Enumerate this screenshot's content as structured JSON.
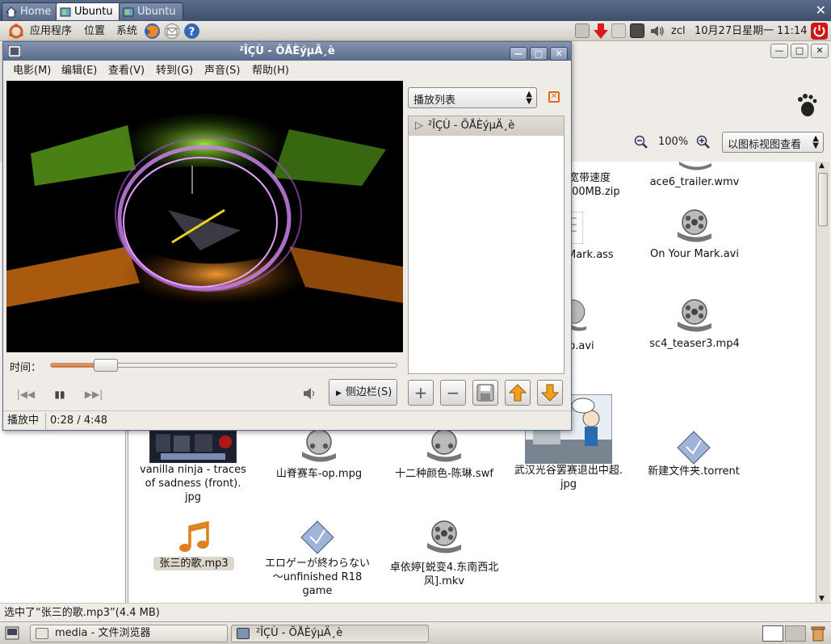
{
  "tabs": [
    {
      "label": "Home",
      "active": false
    },
    {
      "label": "Ubuntu",
      "active": true
    },
    {
      "label": "Ubuntu",
      "active": false
    }
  ],
  "top_panel": {
    "menus": [
      "应用程序",
      "位置",
      "系统"
    ],
    "user": "zcl",
    "date": "10月27日星期一",
    "time": "11:14"
  },
  "file_browser": {
    "zoom": "100%",
    "view_mode": "以图标视图查看",
    "status": "选中了“张三的歌.mp3”(4.4 MB)",
    "files": [
      {
        "name": "…宽带速度 …00MB.zip",
        "l1": "宽带速度",
        "l2": ".00MB.zip",
        "type": "zip"
      },
      {
        "name": "ace6_trailer.wmv",
        "type": "video"
      },
      {
        "name": "Mark.ass",
        "type": "text"
      },
      {
        "name": "On Your Mark.avi",
        "type": "video"
      },
      {
        "name": "p.avi",
        "type": "video"
      },
      {
        "name": "sc4_teaser3.mp4",
        "type": "video"
      },
      {
        "name": "vanilla ninja - traces of sadness (front).jpg",
        "l1": "vanilla ninja - traces",
        "l2": "of sadness (front).",
        "l3": "jpg",
        "type": "image"
      },
      {
        "name": "山脊赛车-op.mpg",
        "type": "video"
      },
      {
        "name": "十二种颜色-陈琳.swf",
        "type": "video"
      },
      {
        "name": "武汉光谷罢赛退出中超.jpg",
        "l1": "武汉光谷罢赛退出中超.",
        "l2": "jpg",
        "type": "image"
      },
      {
        "name": "新建文件夹.torrent",
        "type": "torrent"
      },
      {
        "name": "张三的歌.mp3",
        "type": "audio"
      },
      {
        "name": "エロゲーが終わらない～unfinished R18 game",
        "l1": "エロゲーが終わらない",
        "l2": "～unfinished R18",
        "l3": "game",
        "type": "torrent"
      },
      {
        "name": "卓依婷[蜕变4.东南西北风].mkv",
        "l1": "卓依婷[蜕变4.东南西北",
        "l2": "风].mkv",
        "type": "video"
      }
    ]
  },
  "totem": {
    "title": "²ÎÇÙ - ÕÅÈýµÄ¸è",
    "menu": [
      "电影(M)",
      "编辑(E)",
      "查看(V)",
      "转到(G)",
      "声音(S)",
      "帮助(H)"
    ],
    "time_label": "时间：",
    "progress_fraction": 0.1,
    "sidebar_button": "侧边栏(S)",
    "playlist_selector": "播放列表",
    "playlist_items": [
      "²ÎÇÙ - ÕÅÈýµÄ¸è"
    ],
    "status": "播放中",
    "position": "0:28 / 4:48"
  },
  "taskbar": [
    {
      "label": "media - 文件浏览器",
      "active": false
    },
    {
      "label": "²ÎÇÙ - ÕÅÈýµÄ¸è",
      "active": true
    }
  ],
  "colors": {
    "accent": "#e07020",
    "titlebar": "#5a6b8a",
    "tabbar": "#3e4e6a"
  }
}
